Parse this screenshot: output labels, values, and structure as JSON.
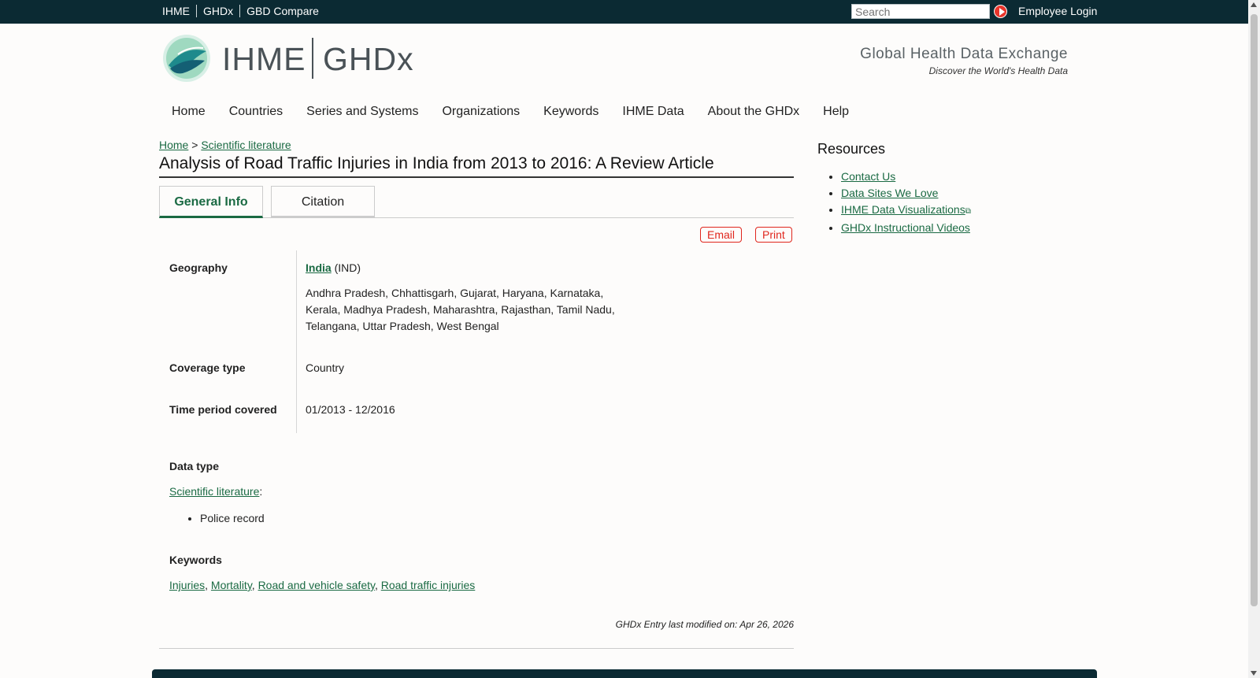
{
  "topbar": {
    "links": [
      "IHME",
      "GHDx",
      "GBD Compare"
    ],
    "search_placeholder": "Search",
    "login": "Employee Login"
  },
  "header": {
    "logo_ihme": "IHME",
    "logo_ghdx": "GHDx",
    "tagline": "Global Health Data Exchange",
    "subtagline": "Discover the World's Health Data"
  },
  "nav": [
    "Home",
    "Countries",
    "Series and Systems",
    "Organizations",
    "Keywords",
    "IHME Data",
    "About the GHDx",
    "Help"
  ],
  "breadcrumb": {
    "home": "Home",
    "separator": ">",
    "section": "Scientific literature"
  },
  "page_title": "Analysis of Road Traffic Injuries in India from 2013 to 2016: A Review Article",
  "tabs": {
    "general": "General Info",
    "citation": "Citation"
  },
  "actions": {
    "email": "Email",
    "print": "Print"
  },
  "info": {
    "geography_label": "Geography",
    "geography_country": "India",
    "geography_code": "(IND)",
    "geography_regions": [
      "Andhra Pradesh, Chhattisgarh, Gujarat, Haryana, Karnataka,",
      "Kerala, Madhya Pradesh, Maharashtra, Rajasthan, Tamil Nadu,",
      "Telangana, Uttar Pradesh, West Bengal"
    ],
    "coverage_label": "Coverage type",
    "coverage_value": "Country",
    "time_label": "Time period covered",
    "time_value": "01/2013 - 12/2016"
  },
  "data_type": {
    "label": "Data type",
    "link": "Scientific literature",
    "colon": ":",
    "items": [
      "Police record"
    ]
  },
  "keywords": {
    "label": "Keywords",
    "items": [
      "Injuries",
      "Mortality",
      "Road and vehicle safety",
      "Road traffic injuries"
    ]
  },
  "modified": "GHDx Entry last modified on: Apr 26, 2026",
  "resources": {
    "title": "Resources",
    "items": [
      "Contact Us",
      "Data Sites We Love",
      "IHME Data Visualizations",
      "GHDx Instructional Videos"
    ]
  },
  "colors": {
    "topbar": "#0b2a33",
    "link": "#1a6a43",
    "accent_red": "#e0261d"
  }
}
